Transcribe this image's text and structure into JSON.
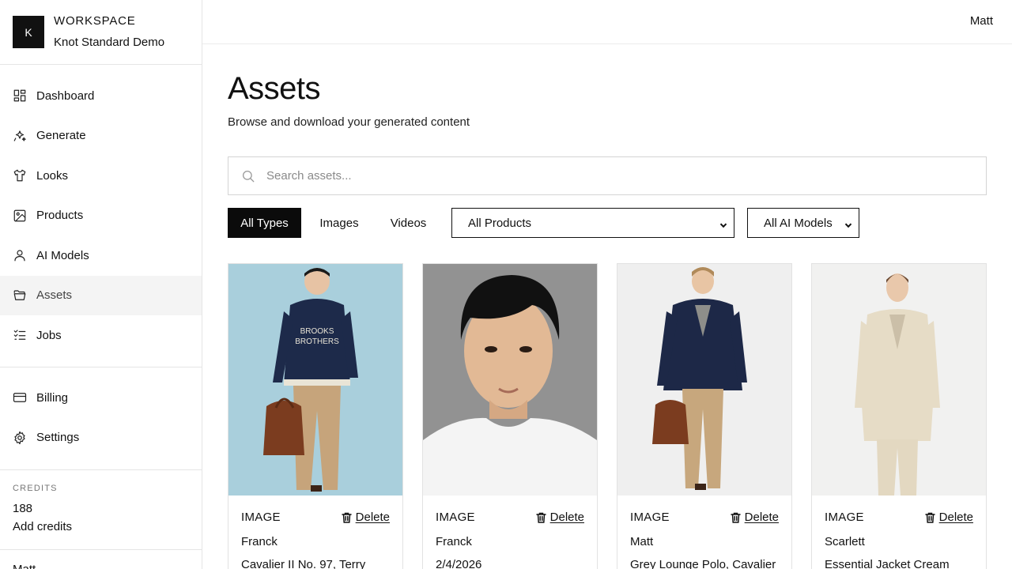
{
  "workspace": {
    "logo_letter": "K",
    "label": "WORKSPACE",
    "name": "Knot Standard Demo"
  },
  "sidebar": {
    "items": [
      {
        "label": "Dashboard",
        "icon": "dashboard-icon"
      },
      {
        "label": "Generate",
        "icon": "sparkles-icon"
      },
      {
        "label": "Looks",
        "icon": "shirt-icon"
      },
      {
        "label": "Products",
        "icon": "image-icon"
      },
      {
        "label": "AI Models",
        "icon": "user-icon"
      },
      {
        "label": "Assets",
        "icon": "folder-icon",
        "active": true
      },
      {
        "label": "Jobs",
        "icon": "checklist-icon"
      }
    ],
    "secondary": [
      {
        "label": "Billing",
        "icon": "credit-card-icon"
      },
      {
        "label": "Settings",
        "icon": "gear-icon"
      }
    ],
    "credits": {
      "label": "CREDITS",
      "value": "188",
      "add_label": "Add credits"
    },
    "user": "Matt"
  },
  "header": {
    "user_name": "Matt"
  },
  "main": {
    "title": "Assets",
    "subtitle": "Browse and download your generated content",
    "search": {
      "placeholder": "Search assets...",
      "icon": "search-icon"
    },
    "filters": {
      "types": [
        {
          "label": "All Types",
          "active": true
        },
        {
          "label": "Images",
          "active": false
        },
        {
          "label": "Videos",
          "active": false
        }
      ],
      "product_select": "All Products",
      "model_select": "All AI Models"
    },
    "assets": [
      {
        "type": "IMAGE",
        "delete_label": "Delete",
        "model": "Franck",
        "meta": "Cavalier II No. 97, Terry",
        "bg": "#a9cfdc"
      },
      {
        "type": "IMAGE",
        "delete_label": "Delete",
        "model": "Franck",
        "meta": "2/4/2026",
        "bg": "#8a8a8a"
      },
      {
        "type": "IMAGE",
        "delete_label": "Delete",
        "model": "Matt",
        "meta": "Grey Lounge Polo, Cavalier",
        "bg": "#efefef"
      },
      {
        "type": "IMAGE",
        "delete_label": "Delete",
        "model": "Scarlett",
        "meta": "Essential Jacket Cream",
        "bg": "#f1f1f0"
      }
    ]
  },
  "colors": {
    "accent": "#0b0b0b",
    "active_nav_bg": "#f4f4f4",
    "border": "#e5e5e5"
  }
}
